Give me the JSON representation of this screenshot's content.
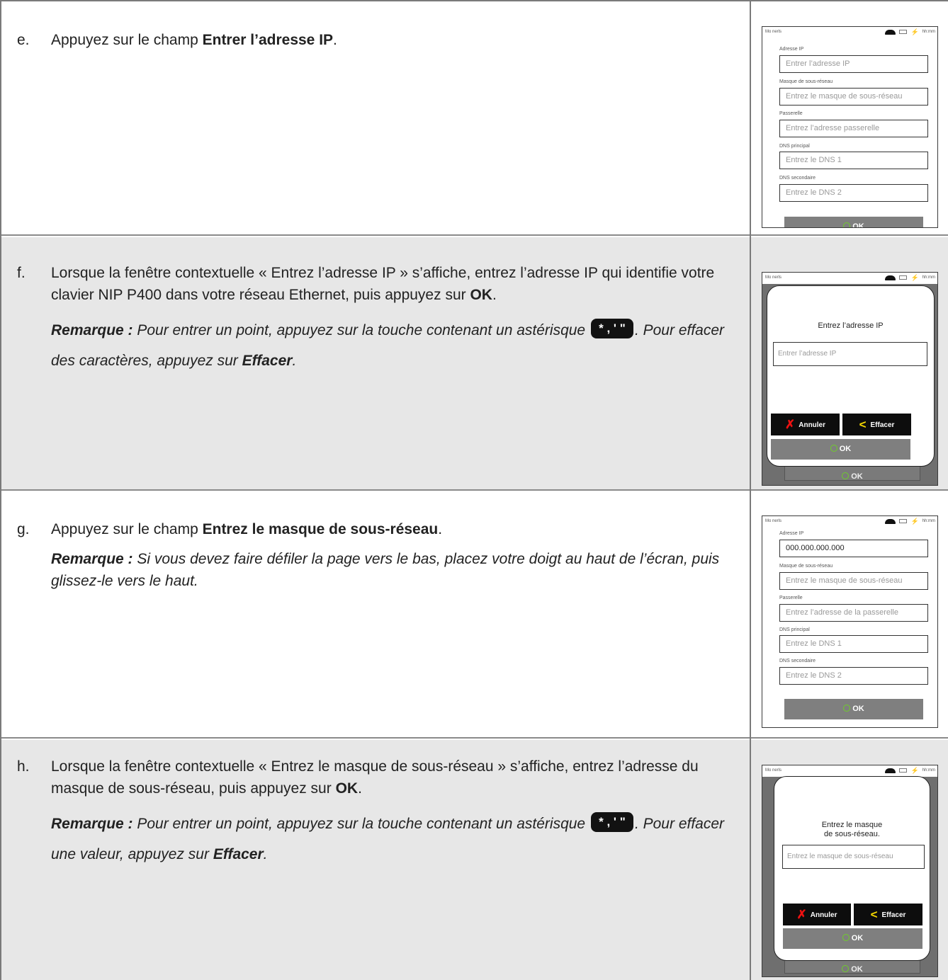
{
  "steps": [
    {
      "letter": "e.",
      "text_pre": "Appuyez sur le champ ",
      "text_bold": "Entrer l’adresse IP",
      "text_post": "."
    },
    {
      "letter": "f.",
      "text_pre": "Lorsque la fenêtre contextuelle « Entrez l’adresse IP » s’affiche, entrez l’adresse IP qui identifie votre clavier NIP P400 dans votre réseau Ethernet, puis appuyez sur ",
      "text_bold": "OK",
      "text_post": ".",
      "note_label": "Remarque :",
      "note_pre": " Pour entrer un point, appuyez sur la touche contenant un astérisque ",
      "note_mid": ". Pour effacer des caractères, appuyez sur ",
      "note_bold": "Effacer",
      "note_post": "."
    },
    {
      "letter": "g.",
      "text_pre": "Appuyez sur le champ ",
      "text_bold": "Entrez le masque de sous-réseau",
      "text_post": ".",
      "note_label": "Remarque :",
      "note_pre": " Si vous devez faire défiler la page vers le bas, placez votre doigt au haut de l’écran, puis glissez-le vers le haut."
    },
    {
      "letter": "h.",
      "text_pre": "Lorsque la fenêtre contextuelle « Entrez le masque de sous-réseau » s’affiche, entrez l’adresse du masque de sous-réseau, puis appuyez sur ",
      "text_bold": "OK",
      "text_post": ".",
      "note_label": "Remarque :",
      "note_pre": " Pour entrer un point, appuyez sur la touche contenant un astérisque ",
      "note_mid": ". Pour effacer une valeur, appuyez sur ",
      "note_bold": "Effacer",
      "note_post": "."
    }
  ],
  "key_label": "* , ' \"",
  "device": {
    "menu": "Mo nerls",
    "time": "hh:mm",
    "icon_cloud": "cloud-icon",
    "icon_tray": "tray-icon",
    "icon_plug": "plug-icon",
    "ok": "OK",
    "cancel": "Annuler",
    "erase": "Effacer"
  },
  "screen_e": {
    "fields": [
      {
        "label": "Adresse IP",
        "placeholder": "Entrer l’adresse IP"
      },
      {
        "label": "Masque de sous-réseau",
        "placeholder": "Entrez le masque de sous-réseau"
      },
      {
        "label": "Passerelle",
        "placeholder": "Entrez l’adresse passerelle"
      },
      {
        "label": "DNS principal",
        "placeholder": "Entrez le DNS 1"
      },
      {
        "label": "DNS secondaire",
        "placeholder": "Entrez le DNS 2"
      }
    ]
  },
  "screen_f": {
    "title": "Entrez l’adresse IP",
    "placeholder": "Entrer l’adresse IP"
  },
  "screen_g": {
    "fields": [
      {
        "label": "Adresse IP",
        "value": "000.000.000.000"
      },
      {
        "label": "Masque de sous-réseau",
        "placeholder": "Entrez le masque de sous-réseau"
      },
      {
        "label": "Passerelle",
        "placeholder": "Entrez l’adresse de la passerelle"
      },
      {
        "label": "DNS principal",
        "placeholder": "Entrez le DNS 1"
      },
      {
        "label": "DNS secondaire",
        "placeholder": "Entrez le DNS 2"
      }
    ]
  },
  "screen_h": {
    "title_line1": "Entrez le masque",
    "title_line2": "de sous-réseau.",
    "placeholder": "Entrez le masque de sous-réseau"
  },
  "colors": {
    "shade": "#e7e7e7",
    "ok_ring": "#6fce2a",
    "cancel_x": "#ee1111",
    "erase_arrow": "#f5d800"
  }
}
